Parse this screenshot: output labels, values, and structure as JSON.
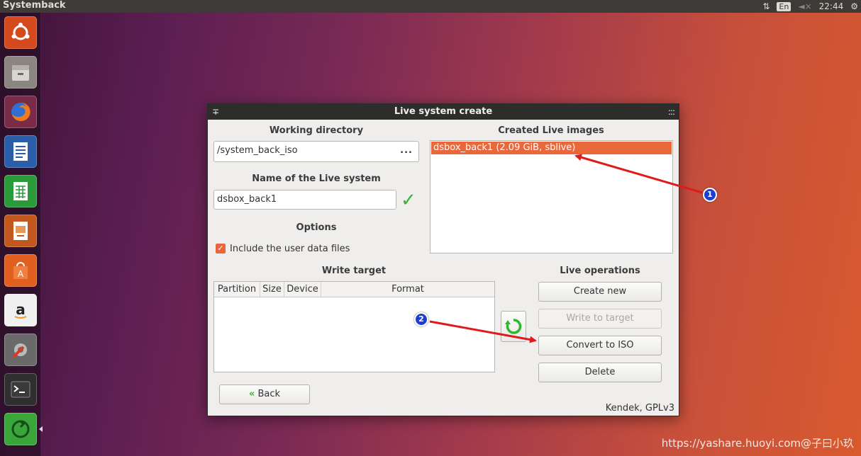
{
  "top_panel": {
    "app_title": "Systemback",
    "keyboard_layout": "En",
    "time": "22:44",
    "icons": [
      "network-arrows-icon",
      "volume-muted-icon",
      "gear-icon"
    ]
  },
  "launcher": {
    "items": [
      {
        "name": "ubuntu-dash",
        "color": "#d4491d"
      },
      {
        "name": "files",
        "color": "#8a8580"
      },
      {
        "name": "firefox",
        "color": "#e8711c"
      },
      {
        "name": "libreoffice-writer",
        "color": "#2a5ea8"
      },
      {
        "name": "libreoffice-calc",
        "color": "#2a9a3a"
      },
      {
        "name": "libreoffice-impress",
        "color": "#c2581d"
      },
      {
        "name": "ubuntu-software",
        "color": "#e2601f"
      },
      {
        "name": "amazon",
        "color": "#f0f0f0"
      },
      {
        "name": "system-settings",
        "color": "#7a7a7a"
      },
      {
        "name": "terminal",
        "color": "#2f2f2f"
      },
      {
        "name": "systemback",
        "color": "#3aa63a"
      }
    ]
  },
  "dialog": {
    "title": "Live system create",
    "titlebar_left": "∓",
    "titlebar_right": ":::",
    "working_directory": {
      "heading": "Working directory",
      "value": "/system_back_iso",
      "browse_label": "..."
    },
    "live_name": {
      "heading": "Name of the Live system",
      "value": "dsbox_back1",
      "valid_mark": "✓"
    },
    "options": {
      "heading": "Options",
      "include_user_data_label": "Include the user data files",
      "include_user_data_checked": true
    },
    "created_images": {
      "heading": "Created Live images",
      "items": [
        "dsbox_back1 (2.09 GiB, sblive)"
      ]
    },
    "write_target": {
      "heading": "Write target",
      "columns": [
        "Partition",
        "Size",
        "Device",
        "Format"
      ]
    },
    "live_operations": {
      "heading": "Live operations",
      "create_new": "Create new",
      "write_to_target": "Write to target",
      "convert_to_iso": "Convert to ISO",
      "delete": "Delete"
    },
    "back_button": {
      "arrows": "«",
      "label": "Back"
    },
    "footer": "Kendek, GPLv3"
  },
  "annotations": {
    "badge_1": "1",
    "badge_2": "2",
    "arrow_color": "#e01b1b"
  },
  "watermark": "https://yashare.huoyi.com@子曰小玖"
}
